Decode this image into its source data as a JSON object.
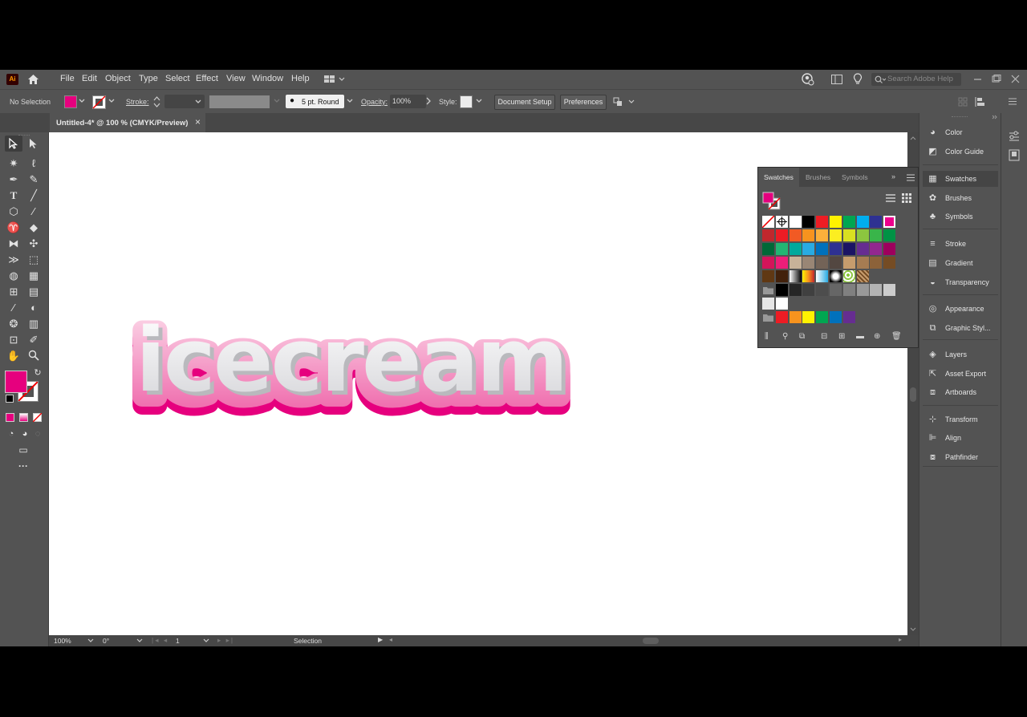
{
  "app": {
    "logo": "Ai"
  },
  "menu": [
    "File",
    "Edit",
    "Object",
    "Type",
    "Select",
    "Effect",
    "View",
    "Window",
    "Help"
  ],
  "search": {
    "placeholder": "Search Adobe Help"
  },
  "control": {
    "selection": "No Selection",
    "fill_color": "#e6007e",
    "stroke_label": "Stroke:",
    "brush": "5 pt. Round",
    "opacity_label": "Opacity:",
    "opacity": "100%",
    "style_label": "Style:",
    "document_setup": "Document Setup",
    "preferences": "Preferences"
  },
  "document_tab": {
    "title": "Untitled-4* @ 100 % (CMYK/Preview)",
    "close": "×"
  },
  "artwork_text": "icecream",
  "status": {
    "zoom": "100%",
    "rotation": "0°",
    "artboard": "1",
    "tool": "Selection"
  },
  "swatches_panel": {
    "tabs": [
      "Swatches",
      "Brushes",
      "Symbols"
    ],
    "rows": [
      [
        "none",
        "reg",
        "#ffffff",
        "#000000",
        "#ed1c24",
        "#fff200",
        "#00a651",
        "#00aeef",
        "#2e3192",
        "#ec008c"
      ],
      [
        "#c1272d",
        "#ed1c24",
        "#f15a24",
        "#f7931e",
        "#fbb03b",
        "#fcee21",
        "#d9e021",
        "#8cc63f",
        "#39b54a",
        "#009245"
      ],
      [
        "#006837",
        "#22b573",
        "#00a99d",
        "#29abe2",
        "#0071bc",
        "#2e3192",
        "#1b1464",
        "#662d91",
        "#93278f",
        "#9e005d"
      ],
      [
        "#d4145a",
        "#ed1e79",
        "#c7b299",
        "#998675",
        "#736357",
        "#534741",
        "#c69c6d",
        "#a67c52",
        "#8c6239",
        "#754c24"
      ],
      [
        "#603813",
        "#42210b",
        "grad-bw",
        "grad-orange",
        "grad-blue",
        "grad-radial",
        "pattern-green",
        "pattern-brown"
      ],
      [
        "folder",
        "#000000",
        "#262626",
        "#404040",
        "#4d4d4d",
        "#666666",
        "#808080",
        "#999999",
        "#b3b3b3",
        "#cccccc"
      ],
      [
        "#e6e6e6",
        "#ffffff"
      ],
      [
        "folder",
        "#ed1c24",
        "#f7931e",
        "#fff200",
        "#00a651",
        "#0071bc",
        "#662d91"
      ]
    ]
  },
  "dock": [
    {
      "label": "Color",
      "icon": "color-icon"
    },
    {
      "label": "Color Guide",
      "icon": "color-guide-icon"
    },
    {
      "label": "Swatches",
      "icon": "swatches-icon"
    },
    {
      "label": "Brushes",
      "icon": "brushes-icon"
    },
    {
      "label": "Symbols",
      "icon": "symbols-icon"
    },
    {
      "label": "Stroke",
      "icon": "stroke-icon"
    },
    {
      "label": "Gradient",
      "icon": "gradient-icon"
    },
    {
      "label": "Transparency",
      "icon": "transparency-icon"
    },
    {
      "label": "Appearance",
      "icon": "appearance-icon"
    },
    {
      "label": "Graphic Styl...",
      "icon": "graphic-styles-icon"
    },
    {
      "label": "Layers",
      "icon": "layers-icon"
    },
    {
      "label": "Asset Export",
      "icon": "asset-export-icon"
    },
    {
      "label": "Artboards",
      "icon": "artboards-icon"
    },
    {
      "label": "Transform",
      "icon": "transform-icon"
    },
    {
      "label": "Align",
      "icon": "align-icon"
    },
    {
      "label": "Pathfinder",
      "icon": "pathfinder-icon"
    }
  ],
  "colors": {
    "magenta": "#e6007e",
    "pink_light": "#f7b8d6",
    "panel": "#535353",
    "dark": "#474747"
  }
}
